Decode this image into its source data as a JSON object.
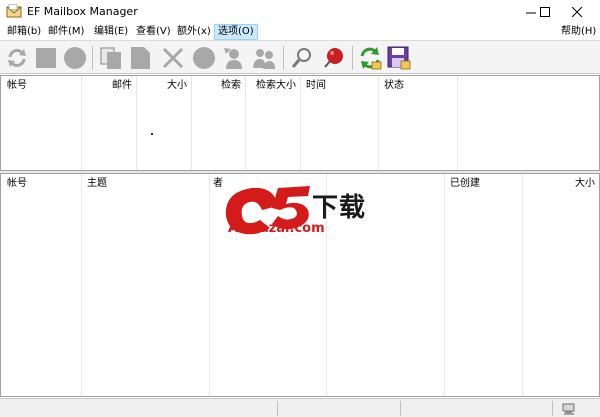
{
  "window": {
    "title": "EF Mailbox Manager",
    "app_icon": "envelope-icon",
    "controls": [
      "minimize-icon",
      "maximize-icon",
      "close-icon"
    ]
  },
  "menubar": {
    "items": [
      {
        "label": "邮箱(b)"
      },
      {
        "label": "邮件(M)"
      },
      {
        "label": "编辑(E)"
      },
      {
        "label": "查看(V)"
      },
      {
        "label": "额外(x)"
      },
      {
        "label": "选项(O)",
        "active": true
      },
      {
        "label": "帮助(H)"
      }
    ]
  },
  "toolbar": {
    "buttons": [
      "refresh-icon",
      "stop-square-icon",
      "record-circle-icon",
      "copy-pages-icon",
      "document-icon",
      "delete-x-icon",
      "circle-icon",
      "user-icon",
      "group-icon",
      "search-magnifier-icon",
      "pin-icon",
      "sync-arrows-icon",
      "save-disk-icon"
    ],
    "colors": {
      "disabled": "#a8a8a8",
      "sync": "#2e9a2e",
      "accent": "#c82020"
    }
  },
  "top_list": {
    "columns": [
      "帐号",
      "邮件",
      "大小",
      "检索",
      "检索大小",
      "时间",
      "状态"
    ]
  },
  "bottom_list": {
    "columns": [
      "帐号",
      "主题",
      "者",
      "已创建",
      "大小"
    ]
  },
  "watermark": {
    "logo_text": "a5",
    "cn_text": "下载",
    "url": "A5xiazai.com",
    "color": "#d51a1a"
  },
  "statusbar": {
    "icon": "network-status-icon"
  }
}
